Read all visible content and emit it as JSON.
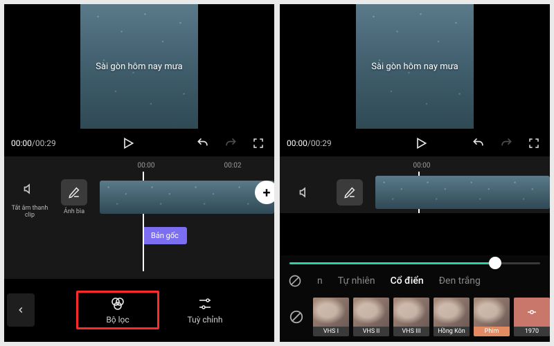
{
  "preview_caption": "Sài gòn hôm nay mưa",
  "time": {
    "current": "00:00",
    "total": "00:29"
  },
  "ruler": {
    "t1": "00:00",
    "t2": "00:02"
  },
  "timeline": {
    "mute_label": "Tắt âm thanh clip",
    "cover_label": "Ảnh bìa",
    "audio_label": "Bản gốc"
  },
  "left_nav": {
    "filter_label": "Bộ lọc",
    "adjust_label": "Tuỳ chỉnh"
  },
  "filter": {
    "slider_value": 82,
    "cat_partial": "n",
    "cat_natural": "Tự nhiên",
    "cat_classic": "Cổ điển",
    "cat_bw": "Đen trắng",
    "thumbs": {
      "vhs1": "VHS I",
      "vhs2": "VHS II",
      "vhs3": "VHS III",
      "hongkong": "Hồng Kôn",
      "phim": "Phim",
      "y1970": "1970"
    }
  }
}
